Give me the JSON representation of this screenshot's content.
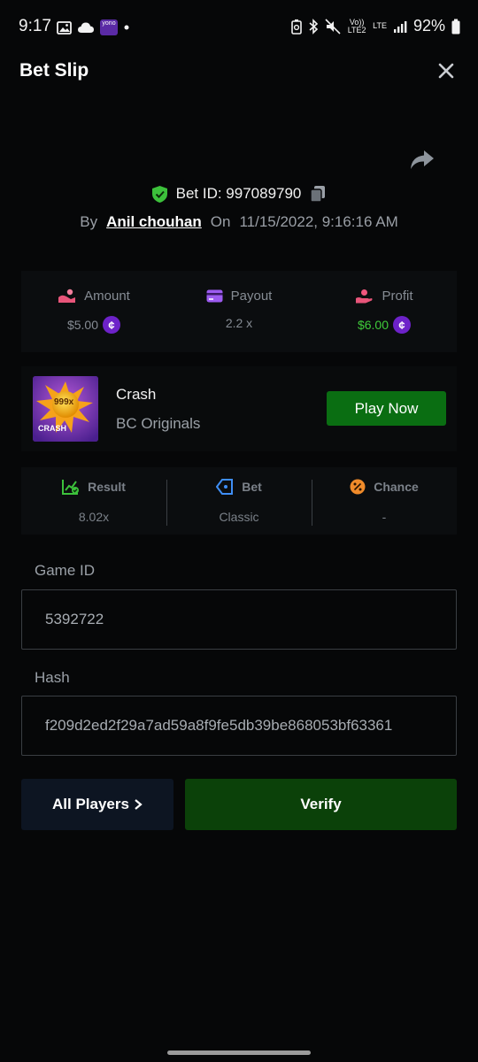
{
  "status_bar": {
    "time": "9:17",
    "battery": "92%",
    "yono_label": "yono",
    "volte_label": "Vo)) LTE2",
    "lte_label": "LTE"
  },
  "header": {
    "title": "Bet Slip"
  },
  "bet": {
    "id_text": "Bet ID: 997089790",
    "by_label": "By",
    "author": "Anil chouhan",
    "on_label": "On",
    "timestamp": "11/15/2022, 9:16:16 AM"
  },
  "stats": [
    {
      "label": "Amount",
      "value": "$5.00",
      "icon": "amount-icon",
      "color": "#868c94",
      "coin": true
    },
    {
      "label": "Payout",
      "value": "2.2 x",
      "icon": "payout-icon",
      "color": "#868c94",
      "coin": false
    },
    {
      "label": "Profit",
      "value": "$6.00",
      "icon": "profit-icon",
      "color": "#3fcb3a",
      "coin": true
    }
  ],
  "coin_symbol": "¢",
  "game": {
    "name": "Crash",
    "provider": "BC Originals",
    "play_label": "Play Now",
    "thumb_badge": "999x",
    "thumb_title": "CRASH"
  },
  "details": [
    {
      "label": "Result",
      "value": "8.02x",
      "icon": "result-chart-icon"
    },
    {
      "label": "Bet",
      "value": "Classic",
      "icon": "bet-tag-icon"
    },
    {
      "label": "Chance",
      "value": "-",
      "icon": "chance-percent-icon"
    }
  ],
  "fields": {
    "game_id_label": "Game ID",
    "game_id_value": "5392722",
    "hash_label": "Hash",
    "hash_value": "f209d2ed2f29a7ad59a8f9fe5db39be868053bf63361"
  },
  "buttons": {
    "all_players": "All Players",
    "verify": "Verify"
  },
  "colors": {
    "background": "#060708",
    "play_button": "#0a6e12",
    "verify_button": "#0b4109",
    "players_button": "#0d1522",
    "profit_green": "#3fcb3a",
    "shield_green": "#3cc13b",
    "coin_purple": "#6d22c9"
  }
}
